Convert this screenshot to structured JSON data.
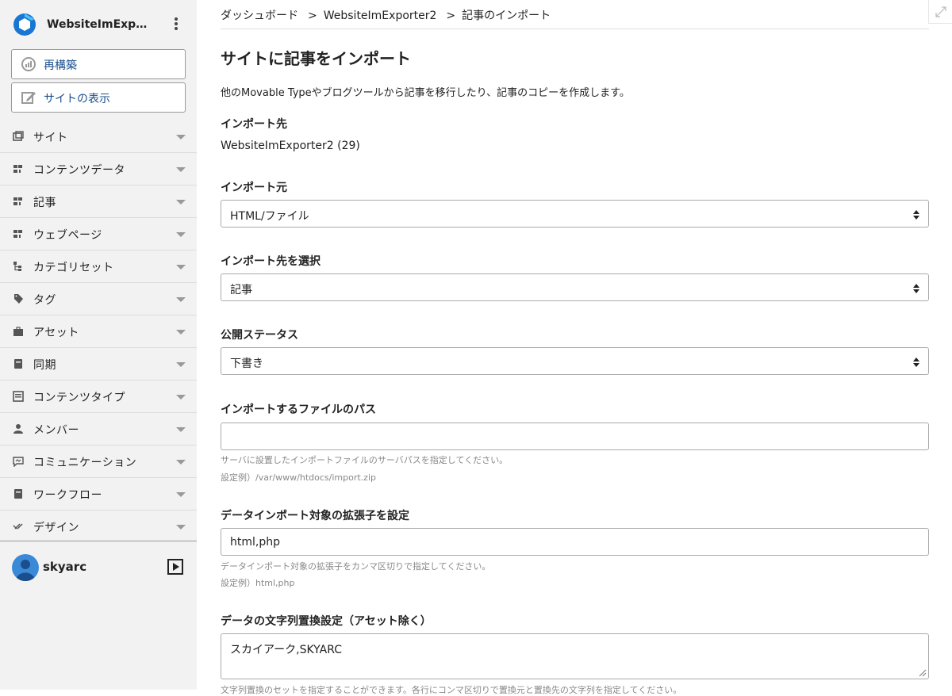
{
  "sidebar": {
    "site_name": "WebsiteImExpor...",
    "rebuild_label": "再構築",
    "view_site_label": "サイトの表示",
    "items": [
      {
        "label": "サイト",
        "icon": "site-icon"
      },
      {
        "label": "コンテンツデータ",
        "icon": "content-data-icon"
      },
      {
        "label": "記事",
        "icon": "entry-icon"
      },
      {
        "label": "ウェブページ",
        "icon": "webpage-icon"
      },
      {
        "label": "カテゴリセット",
        "icon": "category-set-icon"
      },
      {
        "label": "タグ",
        "icon": "tag-icon"
      },
      {
        "label": "アセット",
        "icon": "asset-icon"
      },
      {
        "label": "同期",
        "icon": "sync-icon"
      },
      {
        "label": "コンテンツタイプ",
        "icon": "content-type-icon"
      },
      {
        "label": "メンバー",
        "icon": "member-icon"
      },
      {
        "label": "コミュニケーション",
        "icon": "communication-icon"
      },
      {
        "label": "ワークフロー",
        "icon": "workflow-icon"
      },
      {
        "label": "デザイン",
        "icon": "design-icon"
      }
    ],
    "user": {
      "name": "skyarc"
    }
  },
  "breadcrumb": {
    "items": [
      "ダッシュボード",
      "WebsiteImExporter2",
      "記事のインポート"
    ],
    "separator": ">"
  },
  "page": {
    "title": "サイトに記事をインポート",
    "description": "他のMovable Typeやブログツールから記事を移行したり、記事のコピーを作成します。"
  },
  "form": {
    "import_target_label": "インポート先",
    "import_target_value": "WebsiteImExporter2 (29)",
    "import_source_label": "インポート元",
    "import_source_value": "HTML/ファイル",
    "import_dest_label": "インポート先を選択",
    "import_dest_value": "記事",
    "status_label": "公開ステータス",
    "status_value": "下書き",
    "path_label": "インポートするファイルのパス",
    "path_value": "",
    "path_hint": "サーバに設置したインポートファイルのサーバパスを指定してください。",
    "path_example": "設定例）/var/www/htdocs/import.zip",
    "ext_label": "データインポート対象の拡張子を設定",
    "ext_value": "html,php",
    "ext_hint": "データインポート対象の拡張子をカンマ区切りで指定してください。",
    "ext_example": "設定例）html,php",
    "replace_label": "データの文字列置換設定（アセット除く）",
    "replace_value": "スカイアーク,SKYARC",
    "replace_hint": "文字列置換のセットを指定することができます。各行にコンマ区切りで置換元と置換先の文字列を指定してください。"
  },
  "colors": {
    "sidebar_bg": "#f2f2f2",
    "link_blue": "#1a4f8b",
    "logo_blue": "#1976d2",
    "avatar_blue": "#3b8ad8"
  }
}
